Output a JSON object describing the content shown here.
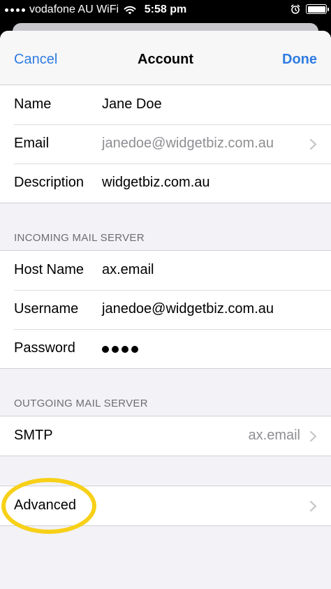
{
  "status_bar": {
    "carrier": "vodafone AU WiFi",
    "time": "5:58 pm",
    "battery_level": 1.0
  },
  "nav": {
    "cancel_label": "Cancel",
    "title": "Account",
    "done_label": "Done"
  },
  "account": {
    "name_label": "Name",
    "name_value": "Jane Doe",
    "email_label": "Email",
    "email_value": "janedoe@widgetbiz.com.au",
    "description_label": "Description",
    "description_value": "widgetbiz.com.au"
  },
  "incoming": {
    "header": "INCOMING MAIL SERVER",
    "host_label": "Host Name",
    "host_value": "ax.email",
    "username_label": "Username",
    "username_value": "janedoe@widgetbiz.com.au",
    "password_label": "Password"
  },
  "outgoing": {
    "header": "OUTGOING MAIL SERVER",
    "smtp_label": "SMTP",
    "smtp_value": "ax.email"
  },
  "advanced": {
    "label": "Advanced"
  },
  "colors": {
    "accent": "#2f7ce0",
    "highlight": "#f7d018",
    "background": "#f2f2f7"
  }
}
